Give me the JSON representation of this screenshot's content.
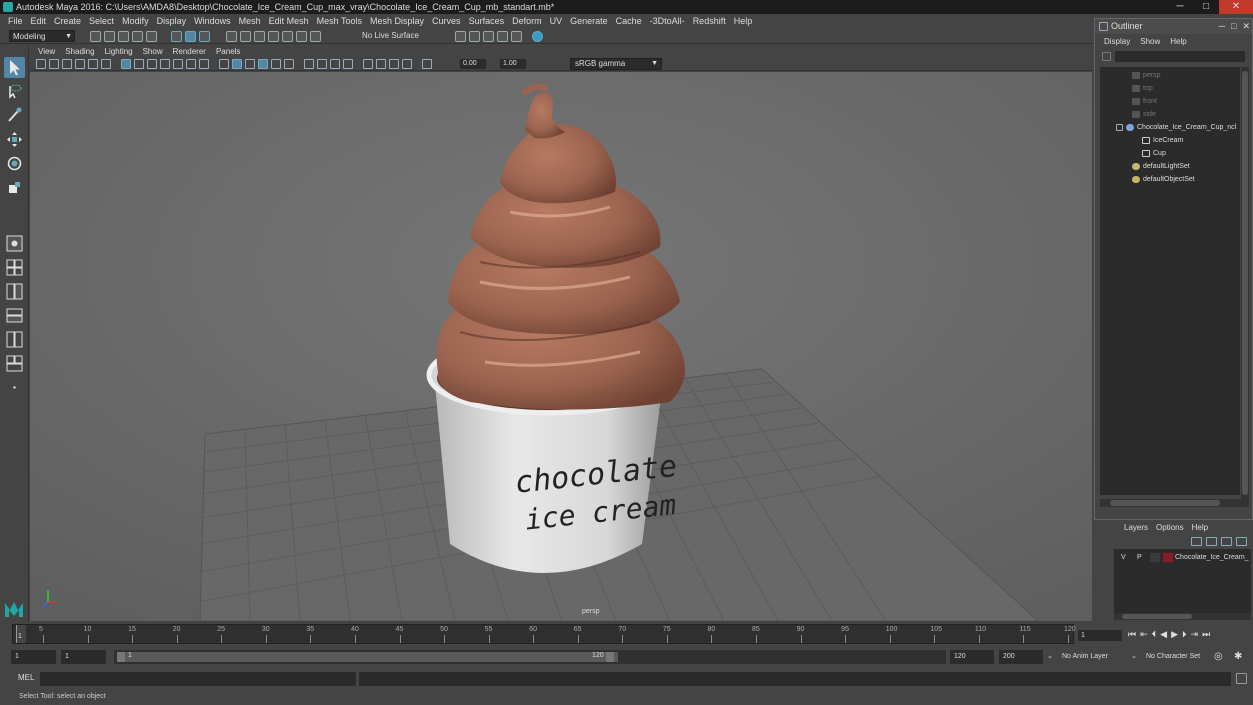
{
  "window": {
    "title": "Autodesk Maya 2016: C:\\Users\\AMDA8\\Desktop\\Chocolate_Ice_Cream_Cup_max_vray\\Chocolate_Ice_Cream_Cup_mb_standart.mb*",
    "minimize": "─",
    "maximize": "□",
    "close": "✕"
  },
  "menubar": [
    "File",
    "Edit",
    "Create",
    "Select",
    "Modify",
    "Display",
    "Windows",
    "Mesh",
    "Edit Mesh",
    "Mesh Tools",
    "Mesh Display",
    "Curves",
    "Surfaces",
    "Deform",
    "UV",
    "Generate",
    "Cache",
    "-3DtoAll-",
    "Redshift",
    "Help"
  ],
  "shelf": {
    "mode": "Modeling",
    "live_surface": "No Live Surface"
  },
  "panel": {
    "menu": [
      "View",
      "Shading",
      "Lighting",
      "Show",
      "Renderer",
      "Panels"
    ],
    "exposure": "0.00",
    "gamma_value": "1.00",
    "color_space": "sRGB gamma",
    "camera_label": "persp"
  },
  "viewport": {
    "cup_text_line1": "chocolate",
    "cup_text_line2": "ice cream",
    "colors": {
      "background": "#6f6f6f",
      "grid": "#5b5b5b",
      "ice_cream": "#9c6450",
      "cup": "#dcdcdc"
    }
  },
  "outliner": {
    "title": "Outliner",
    "menu": [
      "Display",
      "Show",
      "Help"
    ],
    "items": [
      {
        "label": "persp",
        "dim": true
      },
      {
        "label": "top",
        "dim": true
      },
      {
        "label": "front",
        "dim": true
      },
      {
        "label": "side",
        "dim": true
      },
      {
        "label": "Chocolate_Ice_Cream_Cup_ncl",
        "dim": false
      },
      {
        "label": "IceCream",
        "dim": false
      },
      {
        "label": "Cup",
        "dim": false
      },
      {
        "label": "defaultLightSet",
        "dim": false
      },
      {
        "label": "defaultObjectSet",
        "dim": false
      }
    ]
  },
  "layers": {
    "menu": [
      "Layers",
      "Options",
      "Help"
    ],
    "row": {
      "v": "V",
      "p": "P",
      "name": "Chocolate_Ice_Cream_"
    }
  },
  "timeline": {
    "ticks": [
      "5",
      "10",
      "15",
      "20",
      "25",
      "30",
      "35",
      "40",
      "45",
      "50",
      "55",
      "60",
      "65",
      "70",
      "75",
      "80",
      "85",
      "90",
      "95",
      "100",
      "105",
      "110",
      "115",
      "120"
    ],
    "current_frame": "1",
    "current_field": "1"
  },
  "range": {
    "start": "1",
    "anim_start": "1",
    "range_start": "1",
    "range_end": "120",
    "anim_end": "120",
    "end": "200",
    "anim_layer": "No Anim Layer",
    "character_set": "No Character Set"
  },
  "mel": {
    "label": "MEL"
  },
  "status": {
    "help_text": "Select Tool: select an object"
  }
}
